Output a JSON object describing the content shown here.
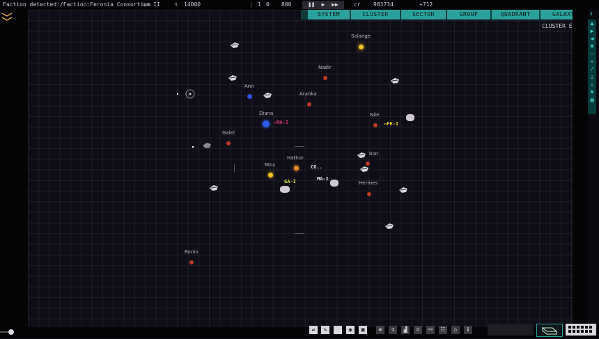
{
  "topbar": {
    "notification": "Faction detected:/Faction:Feronia Consortium",
    "value_a": "II",
    "value_b": "14000",
    "value_c": "1",
    "value_d": "0",
    "value_e": "800",
    "currency_label": "cr",
    "credits": "983734",
    "income": "+712"
  },
  "tabs": [
    "SYSTEM",
    "CLUSTER",
    "SECTOR",
    "GROUP",
    "QUADRANT",
    "GALAXY"
  ],
  "cluster_name": "CLUSTER ELAN",
  "systems": [
    {
      "name": "Solange",
      "color": "#f4c21e"
    },
    {
      "name": "Nadir",
      "color": "#c23a22"
    },
    {
      "name": "Ann",
      "color": "#2b52e0"
    },
    {
      "name": "Aranka",
      "color": "#c23a22"
    },
    {
      "name": "Diana",
      "color": "#2b5ae6"
    },
    {
      "name": "Nile",
      "color": "#c23a22"
    },
    {
      "name": "Galel",
      "color": "#c23a22"
    },
    {
      "name": "Hathor",
      "color": "#ee8a22"
    },
    {
      "name": "Mira",
      "color": "#f4c21e"
    },
    {
      "name": "bon",
      "color": "#c23a22"
    },
    {
      "name": "Hermes",
      "color": "#c23a22"
    },
    {
      "name": "Ronin",
      "color": "#c23a22"
    }
  ],
  "fleets": [
    {
      "label": "MA-I",
      "color": "#e0307a"
    },
    {
      "label": "FE-I",
      "color": "#f1d92c"
    },
    {
      "label": "CO..",
      "color": "#dfe6e6"
    },
    {
      "label": "GA-I",
      "color": "#dfe84a"
    },
    {
      "label": "MA-I",
      "color": "#dfe6e6"
    }
  ]
}
